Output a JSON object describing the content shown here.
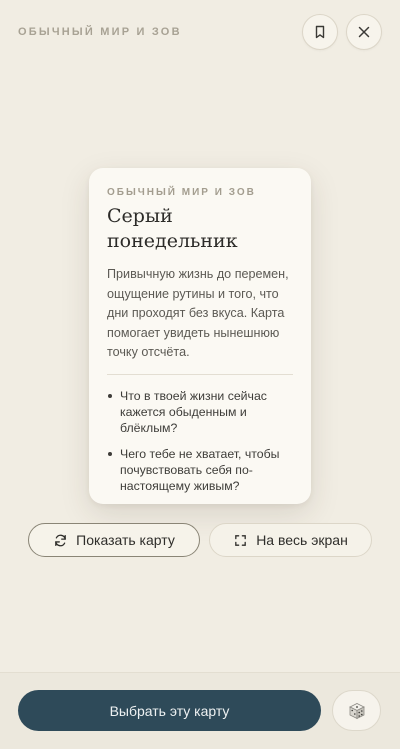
{
  "header": {
    "title": "ОБЫЧНЫЙ МИР И ЗОВ",
    "bookmark_icon": "bookmark-icon",
    "close_icon": "close-icon"
  },
  "card": {
    "eyebrow": "ОБЫЧНЫЙ МИР И ЗОВ",
    "title": "Серый понедельник",
    "description": "Привычную жизнь до перемен, ощущение рутины и того, что дни проходят без вкуса. Карта помогает увидеть нынешнюю точку отсчёта.",
    "questions": [
      "Что в твоей жизни сейчас кажется обыденным и блёклым?",
      "Чего тебе не хватает, чтобы почувствовать себя по-настоящему живым?"
    ]
  },
  "actions": {
    "show_card_label": "Показать карту",
    "fullscreen_label": "На весь экран"
  },
  "bottom": {
    "choose_label": "Выбрать эту карту",
    "dice_icon": "dice-icon"
  },
  "colors": {
    "background": "#f1ede3",
    "primary_button": "#2e4a59",
    "card": "#fbf9f3"
  }
}
